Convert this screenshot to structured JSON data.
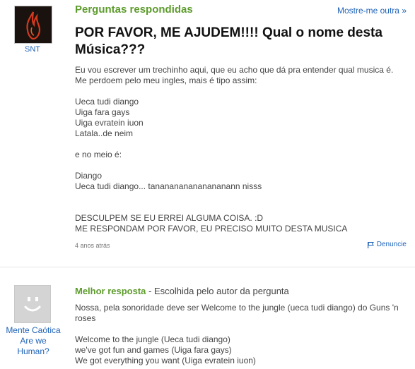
{
  "header": {
    "category": "Perguntas respondidas",
    "more_link": "Mostre-me outra »"
  },
  "question": {
    "author": "SNT",
    "title": "POR FAVOR, ME AJUDEM!!!! Qual o nome desta Música???",
    "paragraphs": [
      [
        "Eu vou escrever um trechinho aqui, que eu acho que dá pra entender qual musica é.",
        "Me perdoem pelo meu ingles, mais é tipo assim:"
      ],
      [
        "Ueca tudi diango",
        "Uiga fara gays",
        "Uiga evratein iuon",
        "Latala..de neim"
      ],
      [
        "e no meio é:"
      ],
      [
        "Diango",
        "Ueca tudi diango... tananananananananann nisss"
      ],
      [
        "DESCULPEM SE EU ERREI ALGUMA COISA. :D",
        "ME RESPONDAM POR FAVOR, EU PRECISO MUITO DESTA MUSICA"
      ]
    ],
    "time": "4 anos atrás",
    "report": "Denuncie"
  },
  "answer": {
    "author": "Mente Caótica Are we Human?",
    "best_label": "Melhor resposta",
    "best_note": " - Escolhida pelo autor da pergunta",
    "paragraphs": [
      [
        "Nossa, pela sonoridade deve ser Welcome to the jungle (ueca tudi diango) do Guns 'n roses"
      ],
      [
        "Welcome to the jungle (Ueca tudi diango)",
        "we've got fun and games (Uiga fara gays)",
        "We got everything you want (Uiga evratein iuon)"
      ]
    ]
  },
  "colors": {
    "accent_green": "#5d9b2c",
    "link_blue": "#1f63b8"
  }
}
